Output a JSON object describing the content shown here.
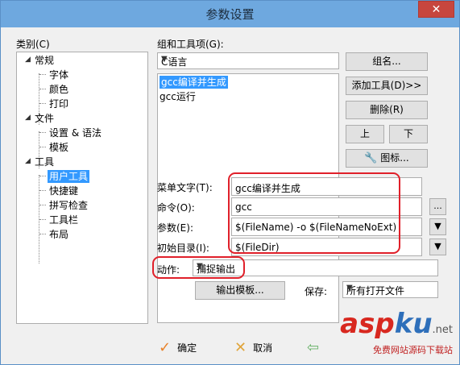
{
  "window": {
    "title": "参数设置",
    "close_label": "✕"
  },
  "category": {
    "label": "类别(C)",
    "tree": [
      {
        "label": "常规",
        "level": 0,
        "expanded": true
      },
      {
        "label": "字体",
        "level": 1
      },
      {
        "label": "颜色",
        "level": 1
      },
      {
        "label": "打印",
        "level": 1
      },
      {
        "label": "文件",
        "level": 0,
        "expanded": true
      },
      {
        "label": "设置 & 语法",
        "level": 1
      },
      {
        "label": "模板",
        "level": 1
      },
      {
        "label": "工具",
        "level": 0,
        "expanded": true
      },
      {
        "label": "用户工具",
        "level": 1,
        "selected": true
      },
      {
        "label": "快捷键",
        "level": 1
      },
      {
        "label": "拼写检查",
        "level": 1
      },
      {
        "label": "工具栏",
        "level": 1
      },
      {
        "label": "布局",
        "level": 1
      }
    ]
  },
  "group": {
    "label": "组和工具项(G):",
    "selected": "C语言",
    "items": [
      {
        "label": "gcc编译并生成",
        "selected": true
      },
      {
        "label": "gcc运行"
      }
    ],
    "buttons": {
      "rename": "组名...",
      "add_tool": "添加工具(D)>>",
      "delete": "删除(R)",
      "up": "上",
      "down": "下",
      "icon": "图标..."
    }
  },
  "fields": {
    "menu_text": {
      "label": "菜单文字(T):",
      "value": "gcc编译并生成"
    },
    "command": {
      "label": "命令(O):",
      "value": "gcc",
      "browse": "..."
    },
    "params": {
      "label": "参数(E):",
      "value": "$(FileName) -o $(FileNameNoExt)"
    },
    "init_dir": {
      "label": "初始目录(I):",
      "value": "$(FileDir)"
    },
    "action": {
      "label": "动作:",
      "value": "捕捉输出"
    },
    "output_template": "输出模板...",
    "save": {
      "label": "保存:",
      "value": "所有打开文件"
    }
  },
  "footer": {
    "ok": "确定",
    "cancel": "取消"
  },
  "watermark": {
    "main_a": "asp",
    "main_k": "ku",
    "net": ".net",
    "sub": "免费网站源码下载站"
  },
  "colors": {
    "titlebar": "#6ea8df",
    "selection": "#3399ff",
    "highlight": "#e0202a",
    "close": "#c7463e"
  }
}
